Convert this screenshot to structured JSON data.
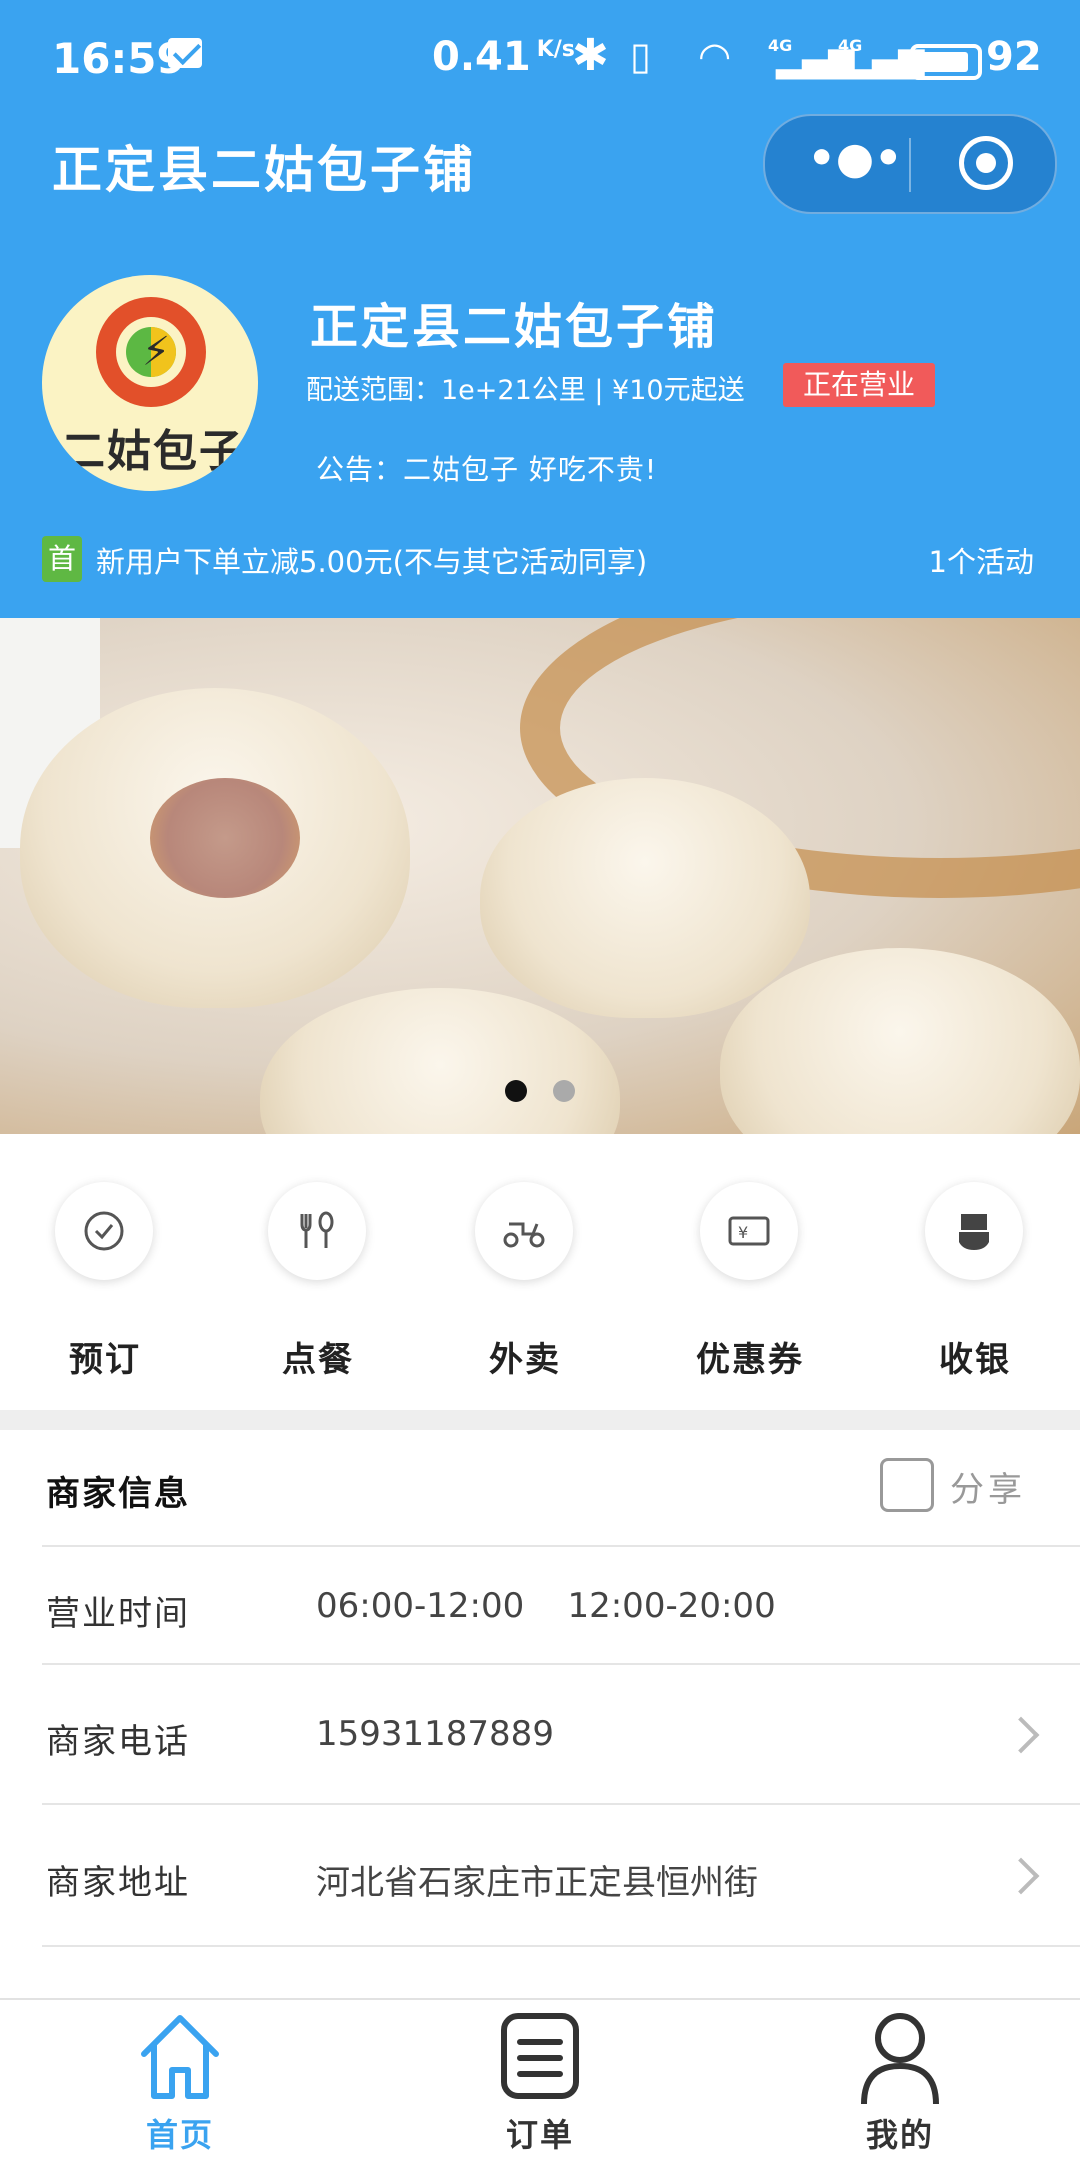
{
  "status": {
    "time": "16:59",
    "speed": "0.41",
    "speed_unit": "K/s",
    "network1": "4G",
    "network2": "4G",
    "battery": "92"
  },
  "titlebar": {
    "title": "正定县二姑包子铺"
  },
  "shop": {
    "logo_text": "二姑包子",
    "name": "正定县二姑包子铺",
    "delivery": "配送范围：1e+21公里 | ¥10元起送",
    "status": "正在营业",
    "notice": "公告：二姑包子 好吃不贵!"
  },
  "promo": {
    "badge": "首",
    "text": "新用户下单立减5.00元(不与其它活动同享)",
    "count": "1个活动"
  },
  "banner": {
    "slides": 2,
    "active": 1
  },
  "menu": [
    {
      "label": "预订",
      "icon": "clock-check-icon"
    },
    {
      "label": "点餐",
      "icon": "fork-spoon-icon"
    },
    {
      "label": "外卖",
      "icon": "scooter-icon"
    },
    {
      "label": "优惠券",
      "icon": "coupon-icon"
    },
    {
      "label": "收银",
      "icon": "cash-hand-icon"
    }
  ],
  "info": {
    "title": "商家信息",
    "share": "分享",
    "rows": [
      {
        "label": "营业时间",
        "value": "06:00-12:00    12:00-20:00"
      },
      {
        "label": "商家电话",
        "value": "15931187889"
      },
      {
        "label": "商家地址",
        "value": "河北省石家庄市正定县恒州街"
      }
    ]
  },
  "tabs": [
    {
      "label": "首页",
      "icon": "home-icon",
      "active": true
    },
    {
      "label": "订单",
      "icon": "order-list-icon",
      "active": false
    },
    {
      "label": "我的",
      "icon": "user-icon",
      "active": false
    }
  ],
  "colors": {
    "primary": "#3aa3f0",
    "badge_red": "#f15a5a",
    "badge_green": "#5fb843",
    "tab_active": "#3aa3f0",
    "tab_inactive": "#333333"
  }
}
